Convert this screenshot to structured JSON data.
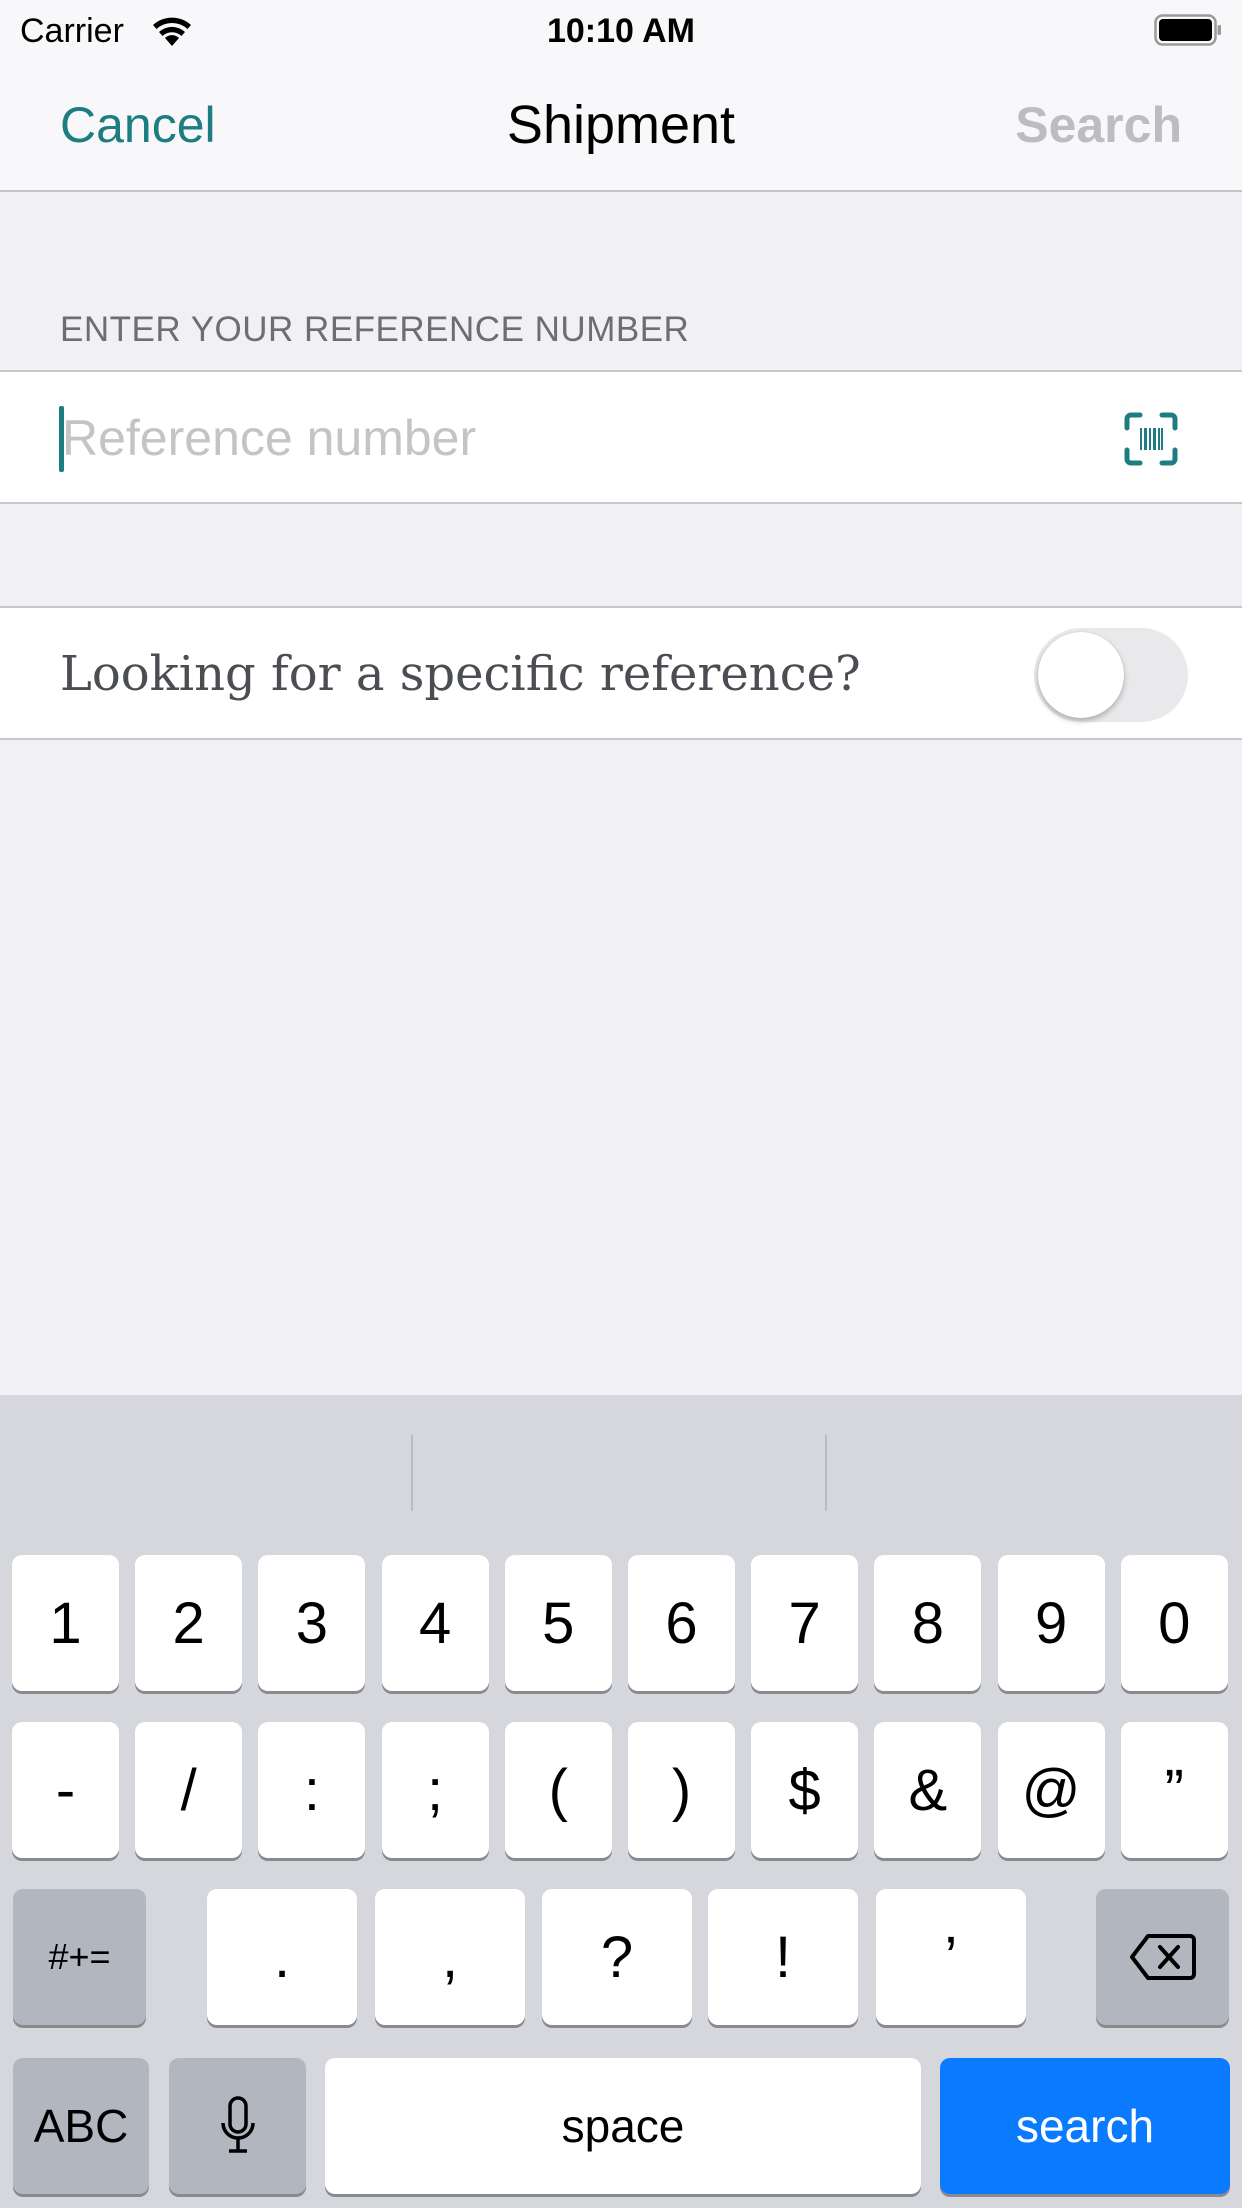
{
  "status_bar": {
    "carrier": "Carrier",
    "time": "10:10 AM",
    "wifi_icon": "wifi-icon",
    "battery_icon": "battery-full-icon"
  },
  "nav": {
    "cancel_label": "Cancel",
    "title": "Shipment",
    "search_label": "Search",
    "search_enabled": false
  },
  "form": {
    "section_header": "ENTER YOUR REFERENCE NUMBER",
    "reference_input": {
      "value": "",
      "placeholder": "Reference number"
    },
    "scan_icon": "barcode-scan-icon",
    "specific_reference": {
      "label": "Looking for a specific reference?",
      "on": false
    }
  },
  "colors": {
    "accent": "#1d7d82",
    "disabled": "#bdbdbf",
    "keyboard_action": "#0a7aff"
  },
  "keyboard": {
    "row1": [
      "1",
      "2",
      "3",
      "4",
      "5",
      "6",
      "7",
      "8",
      "9",
      "0"
    ],
    "row2": [
      "-",
      "/",
      ":",
      ";",
      "(",
      ")",
      "$",
      "&",
      "@",
      "”"
    ],
    "row3": {
      "shift_label": "#+=",
      "keys": [
        ".",
        ",",
        "?",
        "!",
        "’"
      ],
      "delete_icon": "backspace-icon"
    },
    "row4": {
      "abc_label": "ABC",
      "mic_icon": "microphone-icon",
      "space_label": "space",
      "action_label": "search"
    }
  }
}
